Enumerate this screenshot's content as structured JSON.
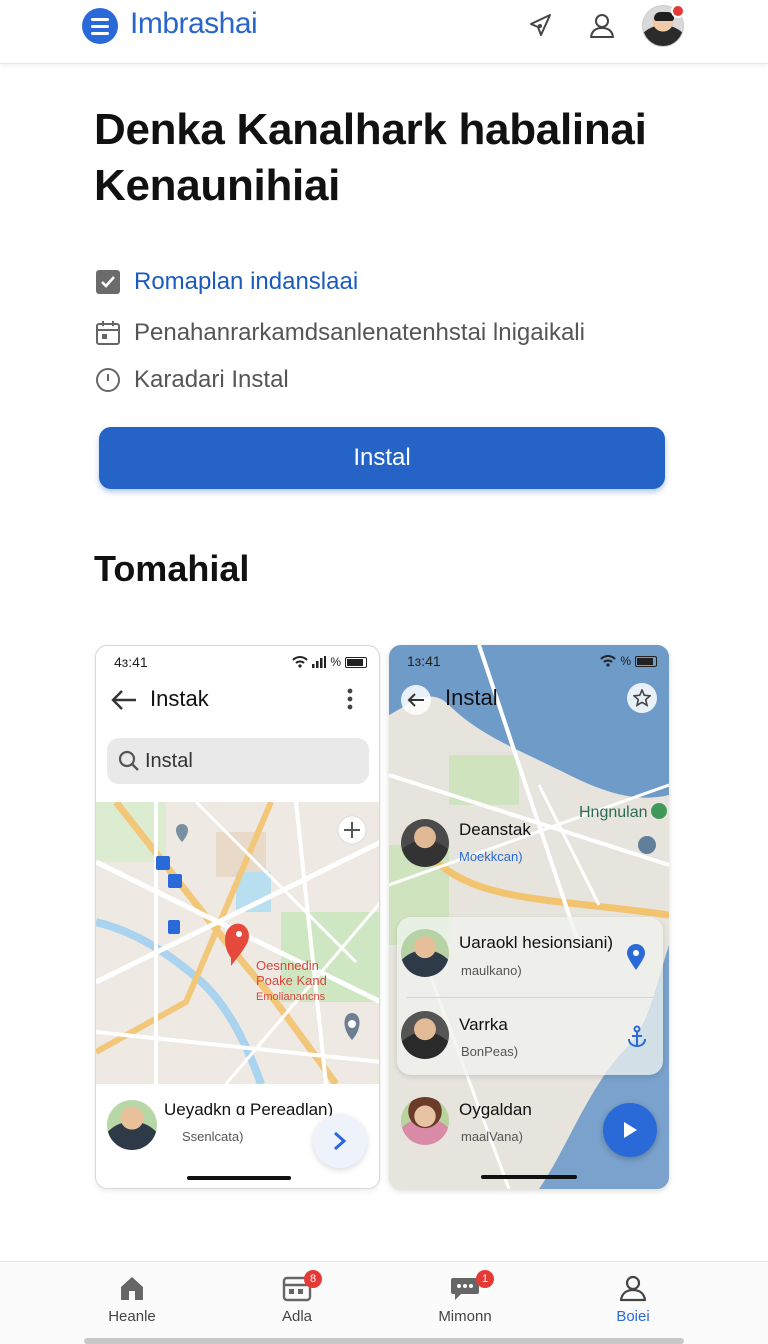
{
  "app": {
    "brand": "Imbrashai",
    "notification_color": "#e53935",
    "accent": "#2563c6"
  },
  "header": {
    "icons": [
      "menu-icon",
      "send-icon",
      "user-icon",
      "avatar"
    ]
  },
  "hero": {
    "title": "Denka Kanalhark habalinai Kenaunihiai",
    "features": [
      {
        "icon": "checkbox-icon",
        "text": "Romaplan indanslaai"
      },
      {
        "icon": "calendar-icon",
        "text": "Penahanrarkamdsanlenatenhstai lnigaikali"
      },
      {
        "icon": "clock-icon",
        "text": "Karadari Instal"
      }
    ],
    "install_label": "Instal"
  },
  "section": {
    "title": "Tomahial"
  },
  "phone_a": {
    "time": "4ɜ:41",
    "signal": "%",
    "title": "Instak",
    "search_placeholder": "Instal",
    "pin_label_1": "Oesnnedin",
    "pin_label_2": "Poake Kand",
    "pin_label_3": "Emolianancns",
    "contact_name": "Ueyadkn ɑ Pereadlan)",
    "contact_sub": "Ssenlcata)"
  },
  "phone_b": {
    "time": "1ɜ:41",
    "signal": "%",
    "title": "Instal",
    "map_label": "Hngnulan",
    "top_contact_name": "Deanstak",
    "top_contact_sub": "Moekkcan)",
    "contacts": [
      {
        "name": "Uaraokl hesionsiani)",
        "sub": "maulkano)"
      },
      {
        "name": "Varrka",
        "sub": "BonPeas)"
      },
      {
        "name": "Oygaldan",
        "sub": "maalVana)"
      }
    ]
  },
  "bottom_nav": {
    "items": [
      {
        "label": "Heanle",
        "icon": "home-icon",
        "badge": ""
      },
      {
        "label": "Adla",
        "icon": "calendar-icon",
        "badge": "8"
      },
      {
        "label": "Mimonn",
        "icon": "chat-icon",
        "badge": "1"
      },
      {
        "label": "Boiei",
        "icon": "profile-icon",
        "badge": ""
      }
    ],
    "active": "Boiei"
  }
}
